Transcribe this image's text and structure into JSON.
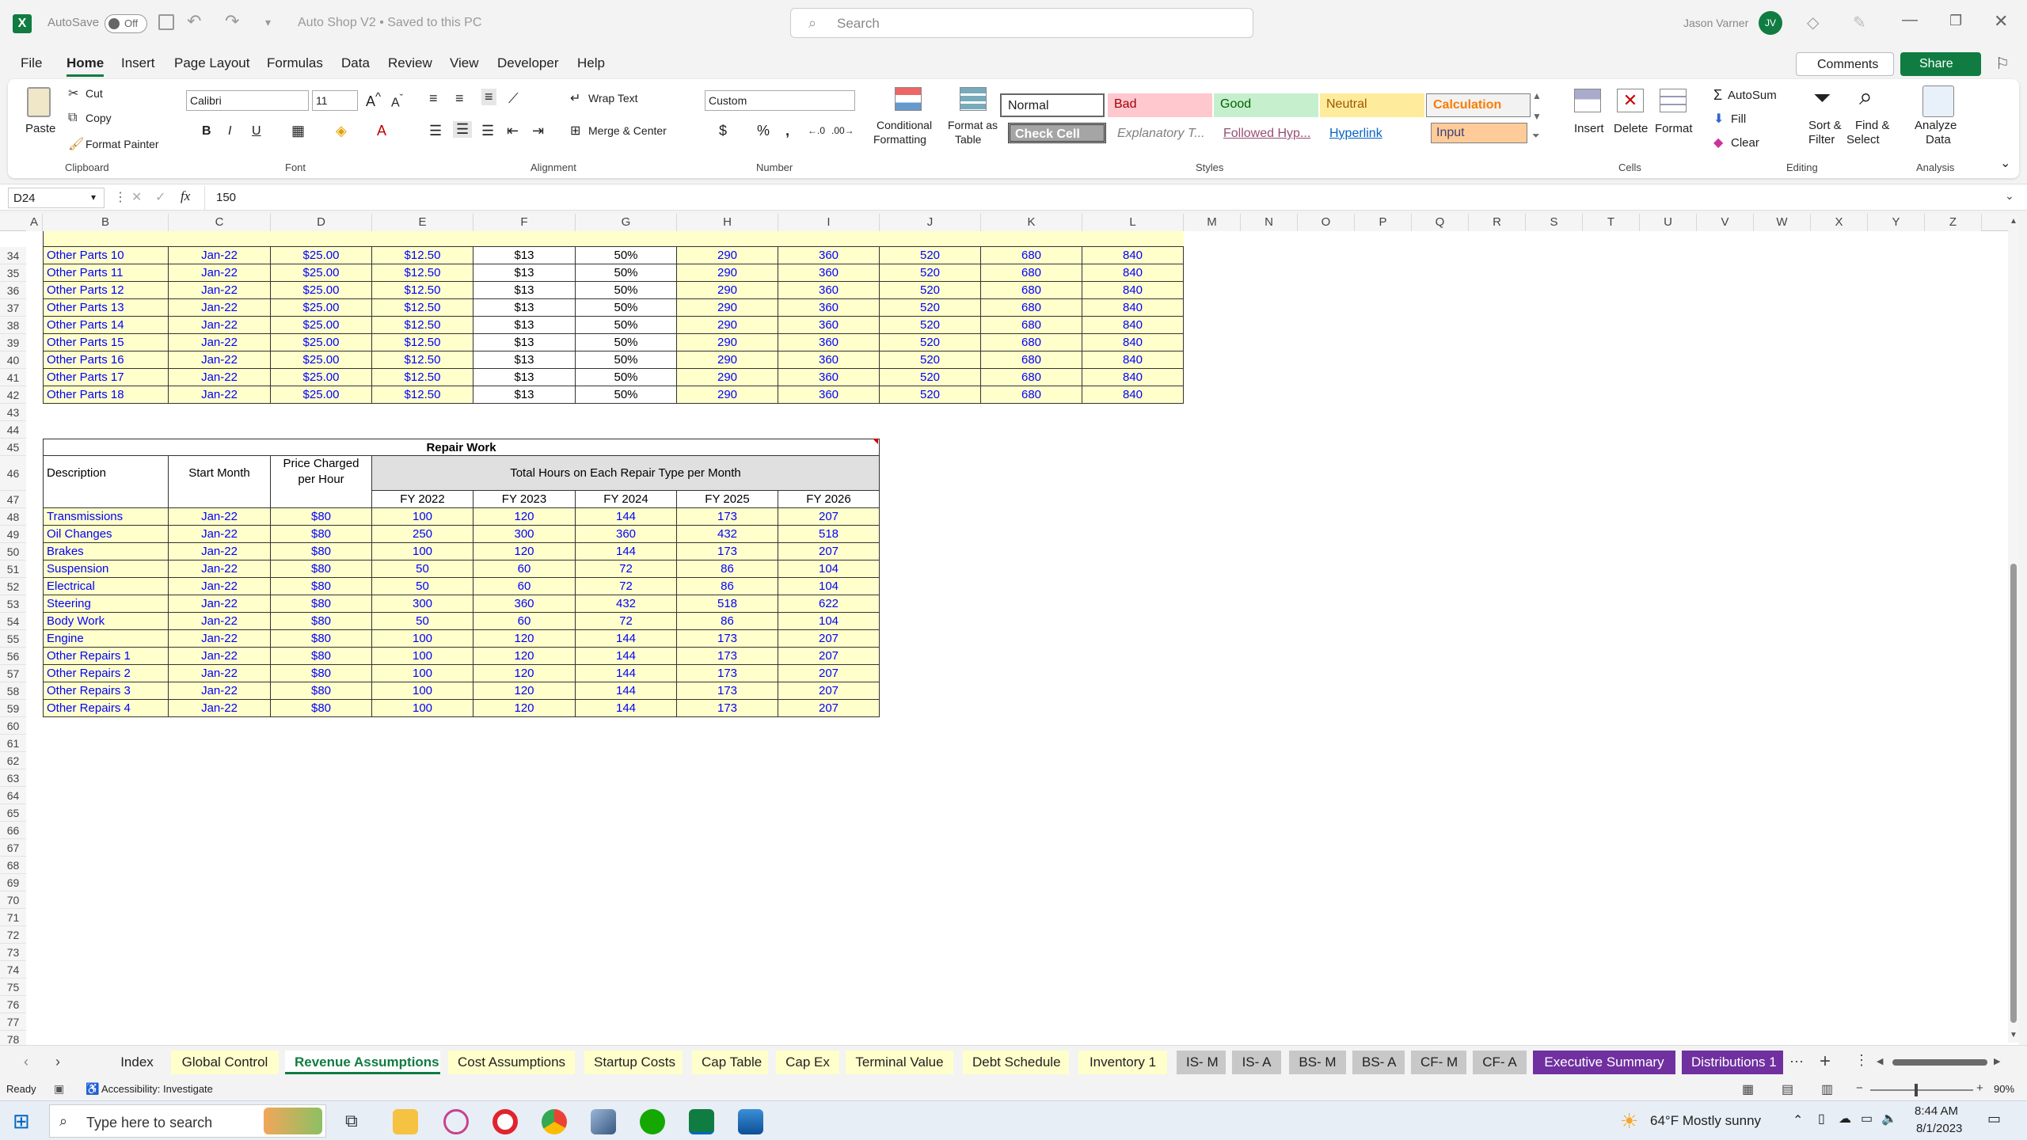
{
  "title": {
    "autosave_label": "AutoSave",
    "autosave_state": "Off",
    "document": "Auto Shop V2 • Saved to this PC",
    "search_placeholder": "Search",
    "user": "Jason Varner",
    "user_initials": "JV"
  },
  "menu": [
    "File",
    "Home",
    "Insert",
    "Page Layout",
    "Formulas",
    "Data",
    "Review",
    "View",
    "Developer",
    "Help"
  ],
  "menu_right": {
    "comments": "Comments",
    "share": "Share"
  },
  "ribbon": {
    "clipboard": {
      "paste": "Paste",
      "cut": "Cut",
      "copy": "Copy",
      "format_painter": "Format Painter",
      "group": "Clipboard"
    },
    "font": {
      "name": "Calibri",
      "size": "11",
      "group": "Font"
    },
    "alignment": {
      "wrap": "Wrap Text",
      "merge": "Merge & Center",
      "group": "Alignment"
    },
    "number": {
      "format": "Custom",
      "group": "Number"
    },
    "styles": {
      "conditional": "Conditional",
      "conditional2": "Formatting",
      "format_table": "Format as",
      "format_table2": "Table",
      "group": "Styles",
      "normal": "Normal",
      "bad": "Bad",
      "good": "Good",
      "neutral": "Neutral",
      "calculation": "Calculation",
      "check": "Check Cell",
      "explanatory": "Explanatory T...",
      "followed": "Followed Hyp...",
      "hyperlink": "Hyperlink",
      "input": "Input"
    },
    "cells": {
      "insert": "Insert",
      "delete": "Delete",
      "format": "Format",
      "group": "Cells"
    },
    "editing": {
      "autosum": "AutoSum",
      "fill": "Fill",
      "clear": "Clear",
      "sort": "Sort &",
      "sort2": "Filter",
      "find": "Find &",
      "find2": "Select",
      "group": "Editing"
    },
    "analysis": {
      "analyze": "Analyze",
      "analyze2": "Data",
      "group": "Analysis"
    }
  },
  "formula": {
    "namebox": "D24",
    "fx": "fx",
    "value": "150"
  },
  "columns": [
    "A",
    "B",
    "C",
    "D",
    "E",
    "F",
    "G",
    "H",
    "I",
    "J",
    "K",
    "L",
    "M",
    "N",
    "O",
    "P",
    "Q",
    "R",
    "S",
    "T",
    "U",
    "V",
    "W",
    "X",
    "Y",
    "Z"
  ],
  "parts": [
    {
      "row": "34",
      "name": "Other Parts 10"
    },
    {
      "row": "35",
      "name": "Other Parts 11"
    },
    {
      "row": "36",
      "name": "Other Parts 12"
    },
    {
      "row": "37",
      "name": "Other Parts 13"
    },
    {
      "row": "38",
      "name": "Other Parts 14"
    },
    {
      "row": "39",
      "name": "Other Parts 15"
    },
    {
      "row": "40",
      "name": "Other Parts 16"
    },
    {
      "row": "41",
      "name": "Other Parts 17"
    },
    {
      "row": "42",
      "name": "Other Parts 18"
    }
  ],
  "parts_values": {
    "month": "Jan-22",
    "d": "$25.00",
    "e": "$12.50",
    "f": "$13",
    "g": "50%",
    "h": "290",
    "i": "360",
    "j": "520",
    "k": "680",
    "l": "840"
  },
  "repair": {
    "title": "Repair Work",
    "h_desc": "Description",
    "h_start": "Start Month",
    "h_price1": "Price Charged",
    "h_price2": "per Hour",
    "h_total": "Total Hours on Each Repair Type per Month",
    "years": [
      "FY 2022",
      "FY 2023",
      "FY 2024",
      "FY 2025",
      "FY 2026"
    ],
    "rows": [
      {
        "row": "48",
        "name": "Transmissions",
        "month": "Jan-22",
        "price": "$80",
        "v": [
          "100",
          "120",
          "144",
          "173",
          "207"
        ]
      },
      {
        "row": "49",
        "name": "Oil Changes",
        "month": "Jan-22",
        "price": "$80",
        "v": [
          "250",
          "300",
          "360",
          "432",
          "518"
        ]
      },
      {
        "row": "50",
        "name": "Brakes",
        "month": "Jan-22",
        "price": "$80",
        "v": [
          "100",
          "120",
          "144",
          "173",
          "207"
        ]
      },
      {
        "row": "51",
        "name": "Suspension",
        "month": "Jan-22",
        "price": "$80",
        "v": [
          "50",
          "60",
          "72",
          "86",
          "104"
        ]
      },
      {
        "row": "52",
        "name": "Electrical",
        "month": "Jan-22",
        "price": "$80",
        "v": [
          "50",
          "60",
          "72",
          "86",
          "104"
        ]
      },
      {
        "row": "53",
        "name": "Steering",
        "month": "Jan-22",
        "price": "$80",
        "v": [
          "300",
          "360",
          "432",
          "518",
          "622"
        ]
      },
      {
        "row": "54",
        "name": "Body Work",
        "month": "Jan-22",
        "price": "$80",
        "v": [
          "50",
          "60",
          "72",
          "86",
          "104"
        ]
      },
      {
        "row": "55",
        "name": "Engine",
        "month": "Jan-22",
        "price": "$80",
        "v": [
          "100",
          "120",
          "144",
          "173",
          "207"
        ]
      },
      {
        "row": "56",
        "name": "Other Repairs 1",
        "month": "Jan-22",
        "price": "$80",
        "v": [
          "100",
          "120",
          "144",
          "173",
          "207"
        ]
      },
      {
        "row": "57",
        "name": "Other Repairs 2",
        "month": "Jan-22",
        "price": "$80",
        "v": [
          "100",
          "120",
          "144",
          "173",
          "207"
        ]
      },
      {
        "row": "58",
        "name": "Other Repairs 3",
        "month": "Jan-22",
        "price": "$80",
        "v": [
          "100",
          "120",
          "144",
          "173",
          "207"
        ]
      },
      {
        "row": "59",
        "name": "Other Repairs 4",
        "month": "Jan-22",
        "price": "$80",
        "v": [
          "100",
          "120",
          "144",
          "173",
          "207"
        ]
      }
    ]
  },
  "empty_rows": [
    "43",
    "44",
    "60",
    "61",
    "62",
    "63",
    "64",
    "65",
    "66",
    "67",
    "68",
    "69",
    "70",
    "71",
    "72",
    "73",
    "74",
    "75",
    "76",
    "77",
    "78"
  ],
  "header_rows": {
    "r45": "45",
    "r46": "46",
    "r47": "47"
  },
  "tabs": [
    {
      "label": "Index",
      "style": "plain"
    },
    {
      "label": "Global Control",
      "style": "yellow"
    },
    {
      "label": "Revenue Assumptions",
      "style": "active"
    },
    {
      "label": "Cost Assumptions",
      "style": "yellow"
    },
    {
      "label": "Startup Costs",
      "style": "yellow"
    },
    {
      "label": "Cap Table",
      "style": "yellow"
    },
    {
      "label": "Cap Ex",
      "style": "yellow"
    },
    {
      "label": "Terminal Value",
      "style": "yellow"
    },
    {
      "label": "Debt Schedule",
      "style": "yellow"
    },
    {
      "label": "Inventory 1",
      "style": "yellow"
    },
    {
      "label": "IS- M",
      "style": "gray"
    },
    {
      "label": "IS- A",
      "style": "gray"
    },
    {
      "label": "BS- M",
      "style": "gray"
    },
    {
      "label": "BS- A",
      "style": "gray"
    },
    {
      "label": "CF- M",
      "style": "gray"
    },
    {
      "label": "CF- A",
      "style": "gray"
    },
    {
      "label": "Executive Summary",
      "style": "purple"
    },
    {
      "label": "Distributions 1",
      "style": "purple"
    }
  ],
  "status": {
    "ready": "Ready",
    "accessibility": "Accessibility: Investigate",
    "zoom": "90%"
  },
  "taskbar": {
    "search_placeholder": "Type here to search",
    "weather": "64°F  Mostly sunny",
    "time": "8:44 AM",
    "date": "8/1/2023"
  },
  "colors": {
    "excel_green": "#107c41",
    "input_yellow": "#ffffcc",
    "input_blue": "#0000ff",
    "purple_tab": "#7030a0"
  }
}
